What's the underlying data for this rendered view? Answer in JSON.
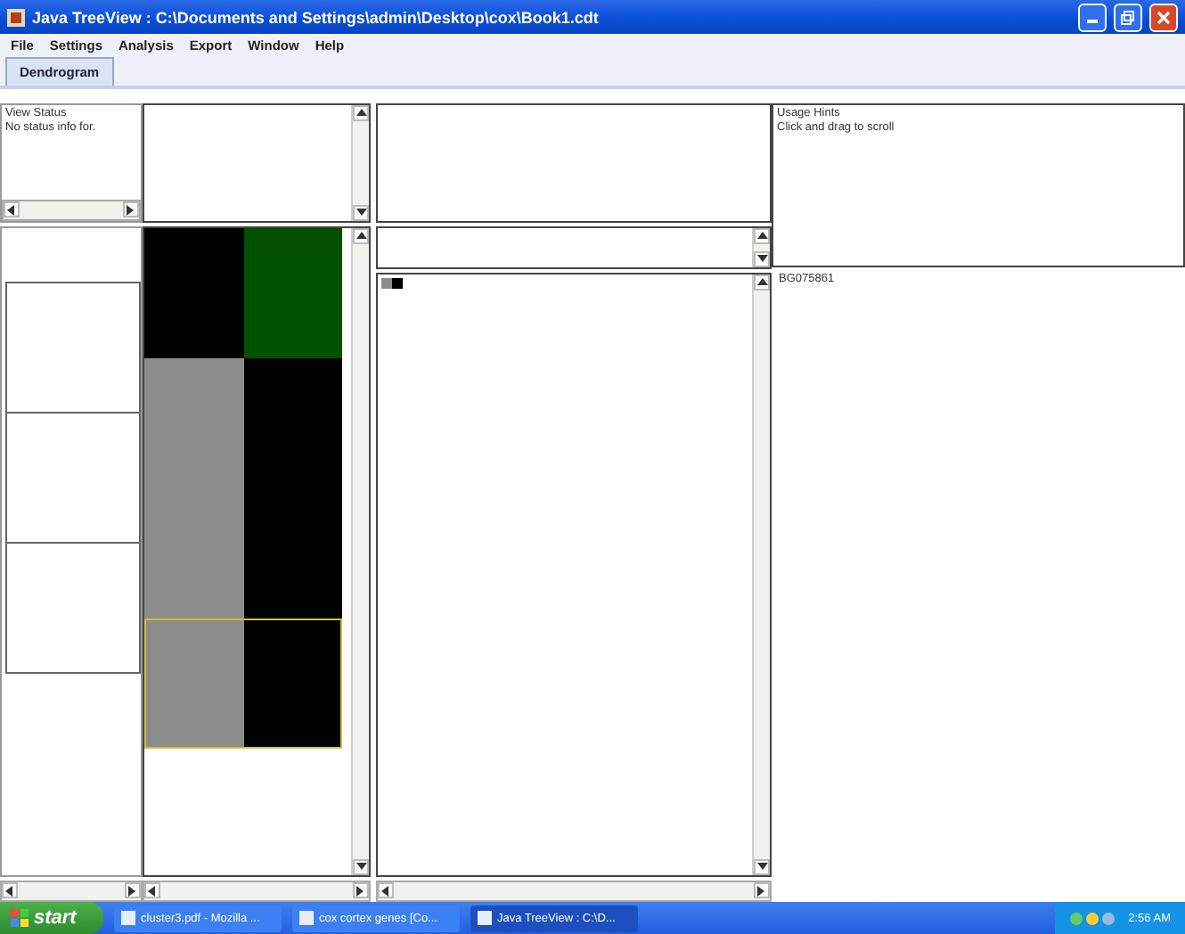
{
  "window": {
    "title": "Java TreeView : C:\\Documents and Settings\\admin\\Desktop\\cox\\Book1.cdt"
  },
  "menu": [
    "File",
    "Settings",
    "Analysis",
    "Export",
    "Window",
    "Help"
  ],
  "tabs": [
    {
      "label": "Dendrogram",
      "selected": true
    }
  ],
  "status_panel": {
    "title": "View Status",
    "text": "No status info for."
  },
  "heatmap": {
    "rows": [
      {
        "selected": false,
        "cells": [
          {
            "color": "#000000"
          },
          {
            "color": "#005000"
          }
        ]
      },
      {
        "selected": false,
        "cells": [
          {
            "color": "#8c8c8c"
          },
          {
            "color": "#000000"
          }
        ]
      },
      {
        "selected": false,
        "cells": [
          {
            "color": "#8c8c8c"
          },
          {
            "color": "#000000"
          }
        ]
      },
      {
        "selected": true,
        "cells": [
          {
            "color": "#8c8c8c"
          },
          {
            "color": "#000000"
          }
        ]
      }
    ]
  },
  "hints": {
    "title": "Usage Hints",
    "text": "Click and drag to scroll"
  },
  "gene_labels": [
    "BG075861"
  ],
  "taskbar": {
    "start": "start",
    "tasks": [
      {
        "label": "cluster3.pdf - Mozilla ...",
        "selected": false
      },
      {
        "label": "cox cortex genes [Co...",
        "selected": false
      },
      {
        "label": "Java TreeView : C:\\D...",
        "selected": true
      }
    ],
    "clock": "2:56 AM"
  }
}
